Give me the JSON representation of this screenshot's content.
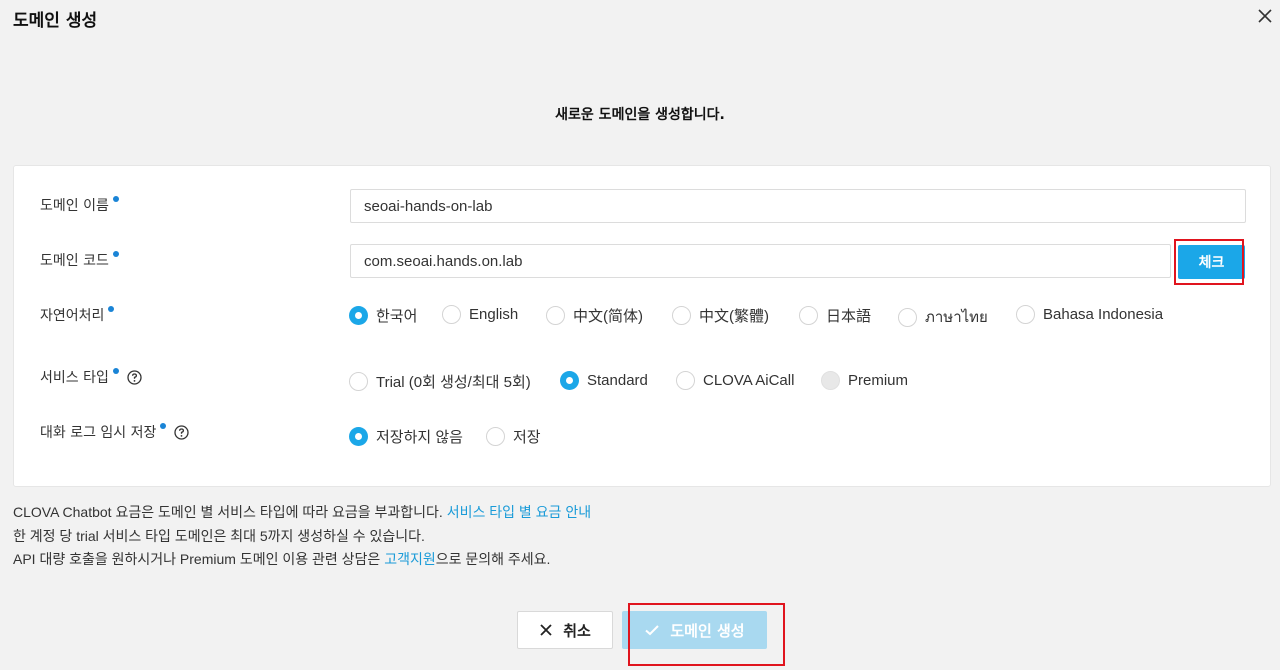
{
  "dialog": {
    "title": "도메인 생성"
  },
  "subtitle": "새로운 도메인을 생성합니다.",
  "form": {
    "domain_name": {
      "label": "도메인 이름",
      "value": "seoai-hands-on-lab"
    },
    "domain_code": {
      "label": "도메인 코드",
      "value": "com.seoai.hands.on.lab",
      "check_label": "체크"
    },
    "nlp": {
      "label": "자연어처리",
      "options": [
        "한국어",
        "English",
        "中文(简体)",
        "中文(繁體)",
        "日本語",
        "ภาษาไทย",
        "Bahasa Indonesia"
      ],
      "selected": "한국어"
    },
    "service_type": {
      "label": "서비스 타입",
      "options": [
        "Trial (0회 생성/최대 5회)",
        "Standard",
        "CLOVA AiCall",
        "Premium"
      ],
      "selected": "Standard",
      "disabled": "Premium"
    },
    "log_storage": {
      "label": "대화 로그 임시 저장",
      "options": [
        "저장하지 않음",
        "저장"
      ],
      "selected": "저장하지 않음"
    }
  },
  "info": {
    "line1_text": "CLOVA Chatbot 요금은 도메인 별 서비스 타입에 따라 요금을 부과합니다.",
    "line1_link": "서비스 타입 별 요금 안내",
    "line2_text": "한 계정 당 trial 서비스 타입 도메인은 최대 5까지 생성하실 수 있습니다.",
    "line3_prefix": "API 대량 호출을 원하시거나 Premium 도메인 이용 관련 상담은",
    "line3_link": "고객지원",
    "line3_suffix": "으로 문의해 주세요."
  },
  "buttons": {
    "cancel": "취소",
    "create": "도메인 생성"
  },
  "colors": {
    "accent": "#1ba7e8",
    "create_disabled": "#a9d9f0",
    "link": "#1a9bd8",
    "highlight": "#e0141e"
  }
}
